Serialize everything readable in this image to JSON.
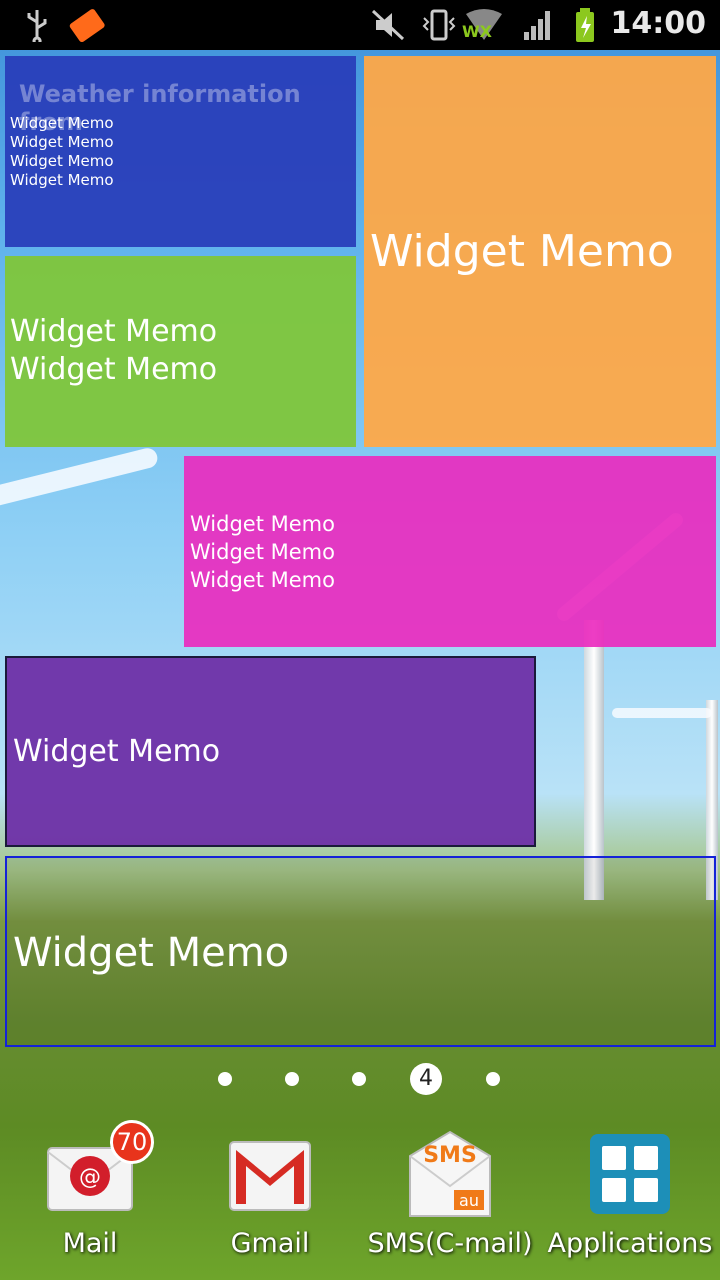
{
  "status_bar": {
    "time": "14:00",
    "icons": [
      "usb-icon",
      "notification-tag-icon",
      "mute-icon",
      "vibrate-icon",
      "wifi-icon",
      "signal-icon",
      "battery-charging-icon"
    ],
    "wifi_label": "WX"
  },
  "widgets": {
    "blue": {
      "background_text": "Weather information from",
      "lines": [
        "Widget Memo",
        "Widget Memo",
        "Widget Memo",
        "Widget Memo"
      ],
      "color": "#283cb9"
    },
    "orange": {
      "lines": [
        "Widget Memo"
      ],
      "color": "#ffa846"
    },
    "green": {
      "lines": [
        "Widget Memo",
        "Widget Memo"
      ],
      "color": "#80c63a"
    },
    "pink": {
      "lines": [
        "Widget Memo",
        "Widget Memo",
        "Widget Memo"
      ],
      "color": "#eb28be"
    },
    "purple": {
      "lines": [
        "Widget Memo"
      ],
      "color": "#6e32a8"
    },
    "clear": {
      "lines": [
        "Widget Memo"
      ],
      "color": "transparent"
    }
  },
  "page_indicator": {
    "current": "4",
    "total": 5
  },
  "dock": [
    {
      "label": "Mail",
      "icon": "mail-icon",
      "badge": "70"
    },
    {
      "label": "Gmail",
      "icon": "gmail-icon"
    },
    {
      "label": "SMS(C-mail)",
      "icon": "sms-icon",
      "icon_text": "SMS",
      "icon_subtext": "au"
    },
    {
      "label": "Applications",
      "icon": "applications-grid-icon"
    }
  ]
}
